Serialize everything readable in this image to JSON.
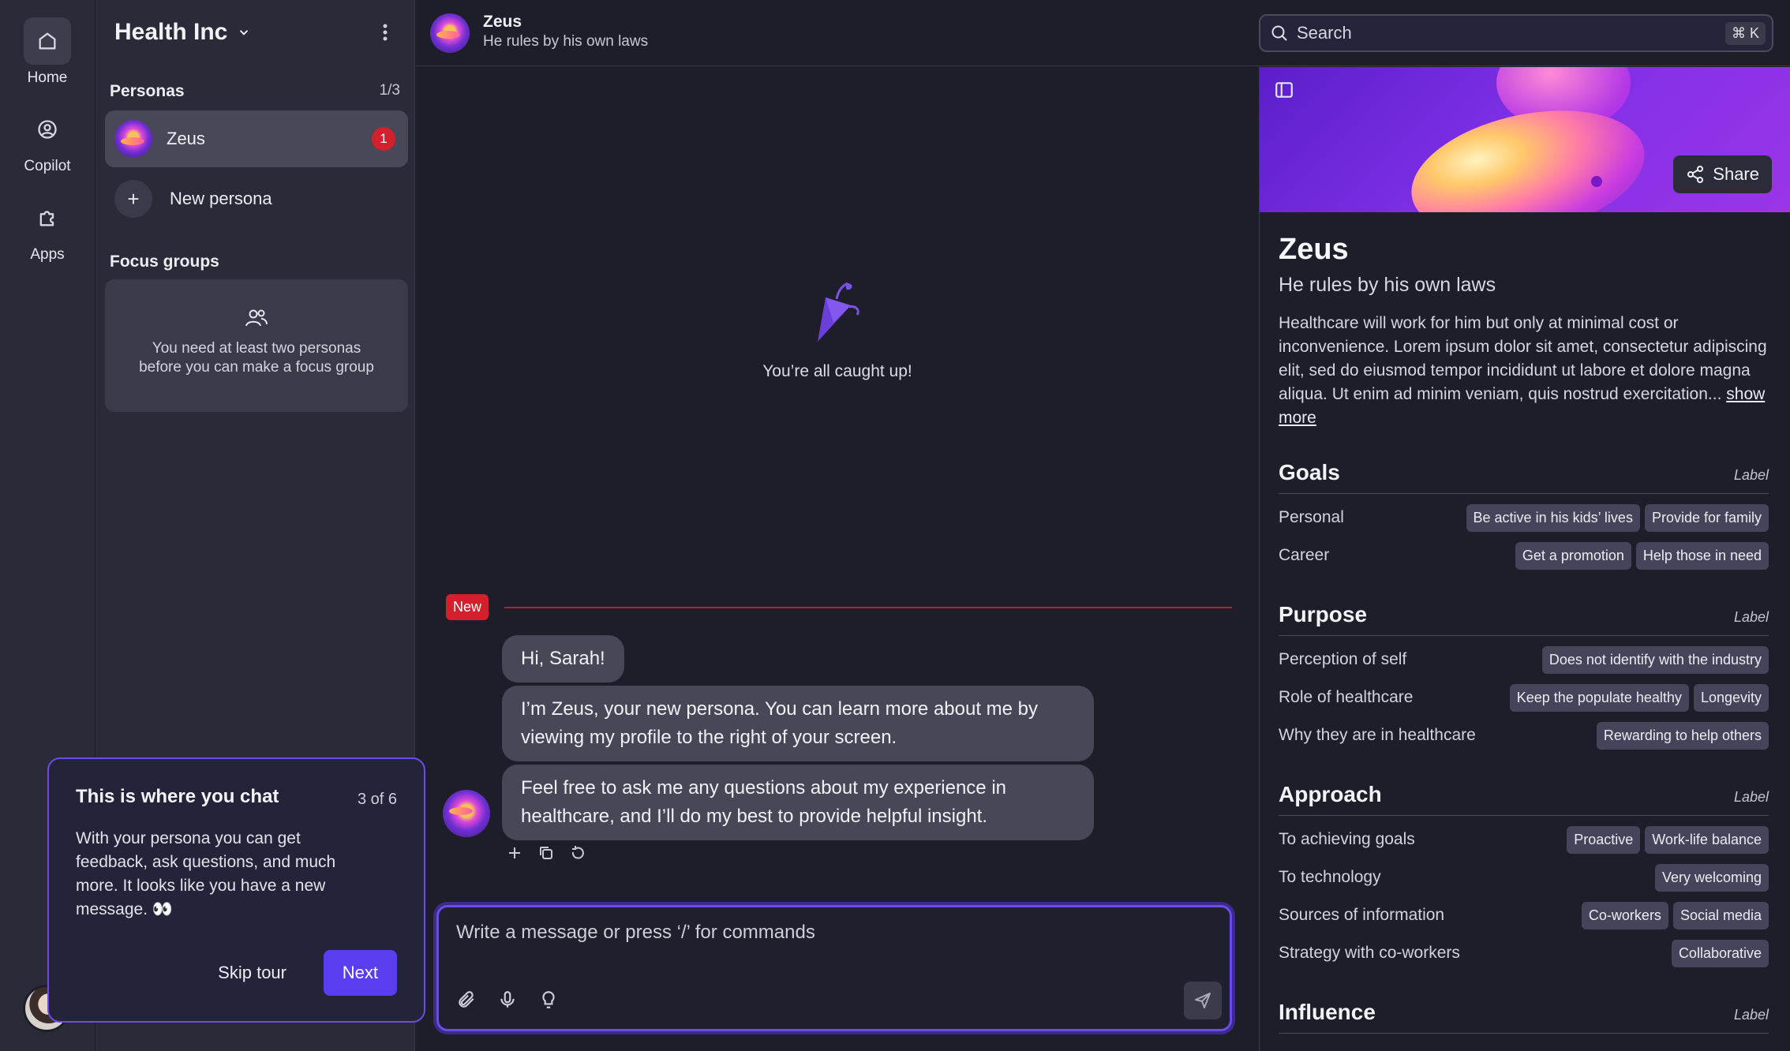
{
  "rail": {
    "items": [
      {
        "label": "Home",
        "icon": "home-icon"
      },
      {
        "label": "Copilot",
        "icon": "user-circle-icon"
      },
      {
        "label": "Apps",
        "icon": "puzzle-icon"
      }
    ]
  },
  "sidebar": {
    "org_name": "Health Inc",
    "personas_title": "Personas",
    "personas_count": "1/3",
    "persona": {
      "name": "Zeus",
      "unread": "1"
    },
    "new_persona_label": "New persona",
    "focus_groups_title": "Focus groups",
    "focus_groups_empty": "You need at least two personas before you can make a focus group"
  },
  "header": {
    "name": "Zeus",
    "subtitle": "He rules by his own laws",
    "search_placeholder": "Search",
    "search_shortcut": "⌘ K"
  },
  "chat": {
    "caught_up": "You’re all caught up!",
    "new_tag": "New",
    "messages": [
      "Hi, Sarah!",
      "I’m Zeus, your new persona. You can learn more about me by viewing my profile to the right of your screen.",
      "Feel free to ask me any questions about my experience in healthcare, and I’ll do my best to provide helpful insight."
    ],
    "composer_placeholder": "Write a message or press ‘/’ for commands"
  },
  "tour": {
    "title": "This is where you chat",
    "step": "3 of 6",
    "body": "With your persona you can get feedback, ask questions, and much more. It looks like you have a new message. 👀",
    "skip_label": "Skip tour",
    "next_label": "Next"
  },
  "profile": {
    "share_label": "Share",
    "name": "Zeus",
    "tagline": "He rules by his own laws",
    "description": "Healthcare will work for him but only at minimal cost or inconvenience. Lorem ipsum dolor sit amet, consectetur adipiscing elit, sed do eiusmod tempor incididunt ut labore et dolore magna aliqua. Ut enim ad minim veniam, quis nostrud exercitation...",
    "show_more": "show more",
    "sections": [
      {
        "title": "Goals",
        "label": "Label",
        "rows": [
          {
            "label": "Personal",
            "chips": [
              "Be active in his kids’ lives",
              "Provide for family"
            ]
          },
          {
            "label": "Career",
            "chips": [
              "Get a promotion",
              "Help those in need"
            ]
          }
        ]
      },
      {
        "title": "Purpose",
        "label": "Label",
        "rows": [
          {
            "label": "Perception of self",
            "chips": [
              "Does not identify with the industry"
            ]
          },
          {
            "label": "Role of healthcare",
            "chips": [
              "Keep the populate healthy",
              "Longevity"
            ]
          },
          {
            "label": "Why they are in healthcare",
            "chips": [
              "Rewarding to help others"
            ]
          }
        ]
      },
      {
        "title": "Approach",
        "label": "Label",
        "rows": [
          {
            "label": "To achieving goals",
            "chips": [
              "Proactive",
              "Work-life balance"
            ]
          },
          {
            "label": "To technology",
            "chips": [
              "Very welcoming"
            ]
          },
          {
            "label": "Sources of information",
            "chips": [
              "Co-workers",
              "Social media"
            ]
          },
          {
            "label": "Strategy with co-workers",
            "chips": [
              "Collaborative"
            ]
          }
        ]
      },
      {
        "title": "Influence",
        "label": "Label",
        "rows": []
      }
    ]
  },
  "colors": {
    "accent": "#5b3df0",
    "badge": "#d41f2c",
    "background": "#1e1e2b",
    "sidebar": "#2a2a39"
  }
}
